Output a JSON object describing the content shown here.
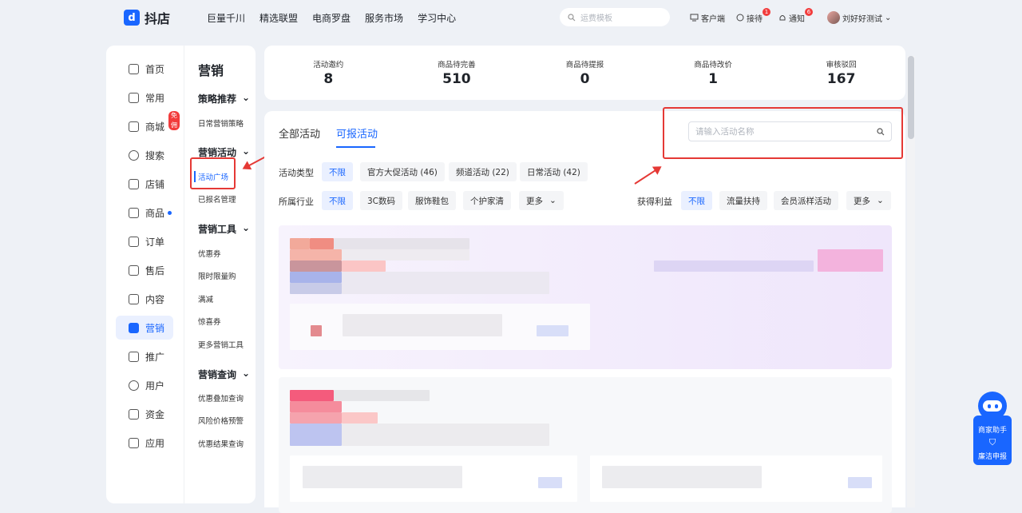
{
  "brand": {
    "name": "抖店",
    "mark": "d"
  },
  "topnav": [
    "巨量千川",
    "精选联盟",
    "电商罗盘",
    "服务市场",
    "学习中心"
  ],
  "top_search": {
    "placeholder": "运费模板"
  },
  "top_right": {
    "client": "客户端",
    "reception": "接待",
    "reception_badge": "1",
    "notice": "通知",
    "notice_badge": "6",
    "user": "刘好好测试"
  },
  "sidebar": {
    "items": [
      {
        "label": "首页",
        "icon": "home-icon"
      },
      {
        "label": "常用",
        "icon": "folder-icon"
      },
      {
        "label": "商城",
        "icon": "shop-icon",
        "badge": "免佣"
      },
      {
        "label": "搜索",
        "icon": "search-icon"
      },
      {
        "label": "店铺",
        "icon": "store-icon"
      },
      {
        "label": "商品",
        "icon": "goods-icon"
      },
      {
        "label": "订单",
        "icon": "order-icon"
      },
      {
        "label": "售后",
        "icon": "aftersale-icon"
      },
      {
        "label": "内容",
        "icon": "content-icon"
      },
      {
        "label": "营销",
        "icon": "megaphone-icon"
      },
      {
        "label": "推广",
        "icon": "promote-icon"
      },
      {
        "label": "用户",
        "icon": "user-icon"
      },
      {
        "label": "资金",
        "icon": "wallet-icon"
      },
      {
        "label": "应用",
        "icon": "app-icon"
      }
    ],
    "sub_title": "营销",
    "groups": [
      {
        "label": "策略推荐",
        "items": [
          "日常营销策略"
        ]
      },
      {
        "label": "营销活动",
        "items": [
          "活动广场",
          "已报名管理"
        ]
      },
      {
        "label": "营销工具",
        "items": [
          "优惠券",
          "限时限量购",
          "满减",
          "惊喜券",
          "更多营销工具"
        ]
      },
      {
        "label": "营销查询",
        "items": [
          "优惠叠加查询",
          "风险价格预警",
          "优惠结果查询"
        ]
      }
    ]
  },
  "stats": [
    {
      "label": "活动邀约",
      "value": "8"
    },
    {
      "label": "商品待完善",
      "value": "510"
    },
    {
      "label": "商品待提报",
      "value": "0"
    },
    {
      "label": "商品待改价",
      "value": "1"
    },
    {
      "label": "审核驳回",
      "value": "167"
    }
  ],
  "tabs": [
    "全部活动",
    "可报活动"
  ],
  "search": {
    "placeholder": "请输入活动名称"
  },
  "filters": {
    "type_label": "活动类型",
    "type_options": [
      "不限",
      "官方大促活动 (46)",
      "频道活动 (22)",
      "日常活动 (42)"
    ],
    "industry_label": "所属行业",
    "industry_options": [
      "不限",
      "3C数码",
      "服饰鞋包",
      "个护家清",
      "更多"
    ],
    "benefit_label": "获得利益",
    "benefit_options": [
      "不限",
      "流量扶持",
      "会员派样活动",
      "更多"
    ]
  },
  "assistant": {
    "label": "商家助手",
    "report": "廉洁申报"
  },
  "colors": {
    "accent": "#1966ff",
    "highlight": "#e53935"
  }
}
